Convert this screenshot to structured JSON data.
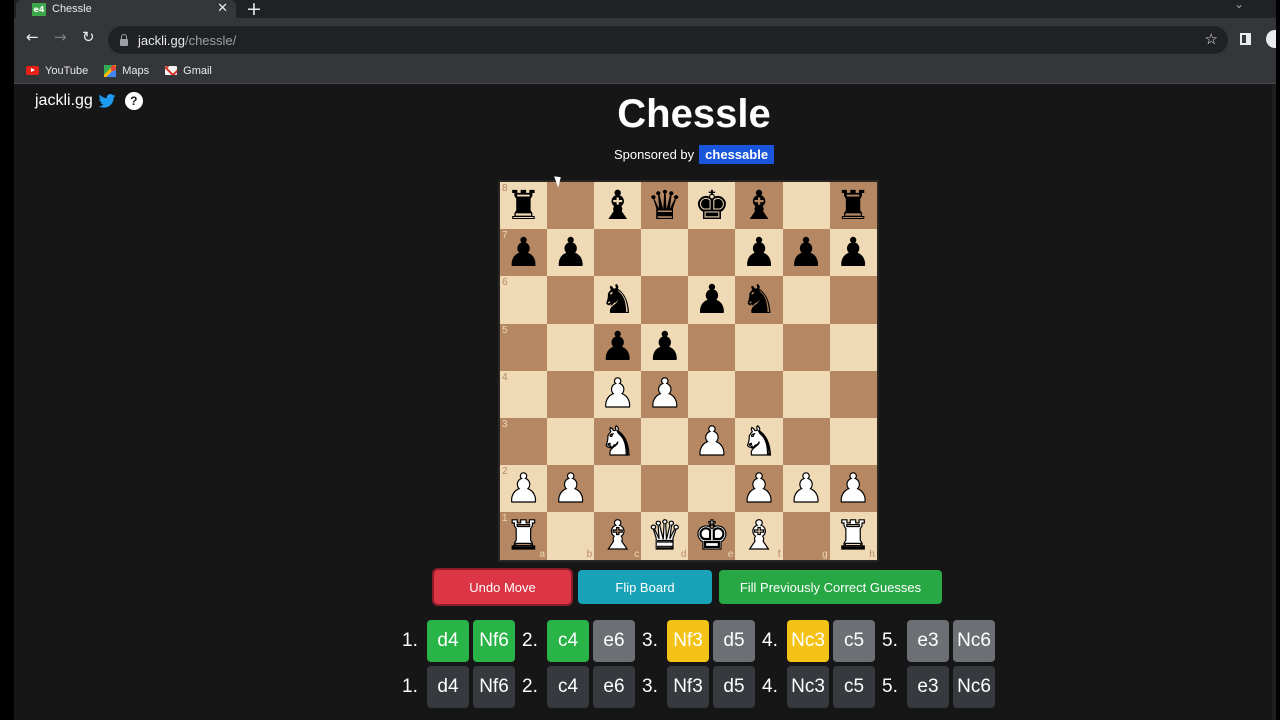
{
  "browser": {
    "tab": {
      "favicon_text": "e4",
      "title": "Chessle"
    },
    "url": {
      "host": "jackli.gg",
      "path": "/chessle/"
    },
    "bookmarks": [
      {
        "label": "YouTube",
        "icon": "youtube-icon"
      },
      {
        "label": "Maps",
        "icon": "maps-icon"
      },
      {
        "label": "Gmail",
        "icon": "gmail-icon"
      }
    ]
  },
  "header": {
    "brand": "jackli.gg",
    "title": "Chessle",
    "sponsor_text": "Sponsored by",
    "sponsor_name": "chessable"
  },
  "board": {
    "files": [
      "a",
      "b",
      "c",
      "d",
      "e",
      "f",
      "g",
      "h"
    ],
    "ranks": [
      "8",
      "7",
      "6",
      "5",
      "4",
      "3",
      "2",
      "1"
    ],
    "position": [
      [
        "bR",
        "",
        "bB",
        "bQ",
        "bK",
        "bB",
        "",
        "bR"
      ],
      [
        "bP",
        "bP",
        "",
        "",
        "",
        "bP",
        "bP",
        "bP"
      ],
      [
        "",
        "",
        "bN",
        "",
        "bP",
        "bN",
        "",
        ""
      ],
      [
        "",
        "",
        "bP",
        "bP",
        "",
        "",
        "",
        ""
      ],
      [
        "",
        "",
        "wP",
        "wP",
        "",
        "",
        "",
        ""
      ],
      [
        "",
        "",
        "wN",
        "",
        "wP",
        "wN",
        "",
        ""
      ],
      [
        "wP",
        "wP",
        "",
        "",
        "",
        "wP",
        "wP",
        "wP"
      ],
      [
        "wR",
        "",
        "wB",
        "wQ",
        "wK",
        "wB",
        "",
        "wR"
      ]
    ]
  },
  "actions": {
    "undo": "Undo Move",
    "flip": "Flip Board",
    "fill": "Fill Previously Correct Guesses"
  },
  "colors": {
    "correct": "#28b446",
    "misplaced": "#f5c318",
    "wrong": "#6c7075",
    "input": "#36393d"
  },
  "guesses": [
    [
      {
        "num": "1.",
        "white": {
          "san": "d4",
          "status": "green"
        },
        "black": {
          "san": "Nf6",
          "status": "green"
        }
      },
      {
        "num": "2.",
        "white": {
          "san": "c4",
          "status": "green"
        },
        "black": {
          "san": "e6",
          "status": "gray"
        }
      },
      {
        "num": "3.",
        "white": {
          "san": "Nf3",
          "status": "yellow"
        },
        "black": {
          "san": "d5",
          "status": "gray"
        }
      },
      {
        "num": "4.",
        "white": {
          "san": "Nc3",
          "status": "yellow"
        },
        "black": {
          "san": "c5",
          "status": "gray"
        }
      },
      {
        "num": "5.",
        "white": {
          "san": "e3",
          "status": "gray"
        },
        "black": {
          "san": "Nc6",
          "status": "gray"
        }
      }
    ],
    [
      {
        "num": "1.",
        "white": {
          "san": "d4",
          "status": "dark"
        },
        "black": {
          "san": "Nf6",
          "status": "dark"
        }
      },
      {
        "num": "2.",
        "white": {
          "san": "c4",
          "status": "dark"
        },
        "black": {
          "san": "e6",
          "status": "dark"
        }
      },
      {
        "num": "3.",
        "white": {
          "san": "Nf3",
          "status": "dark"
        },
        "black": {
          "san": "d5",
          "status": "dark"
        }
      },
      {
        "num": "4.",
        "white": {
          "san": "Nc3",
          "status": "dark"
        },
        "black": {
          "san": "c5",
          "status": "dark"
        }
      },
      {
        "num": "5.",
        "white": {
          "san": "e3",
          "status": "dark"
        },
        "black": {
          "san": "Nc6",
          "status": "dark"
        }
      }
    ]
  ]
}
